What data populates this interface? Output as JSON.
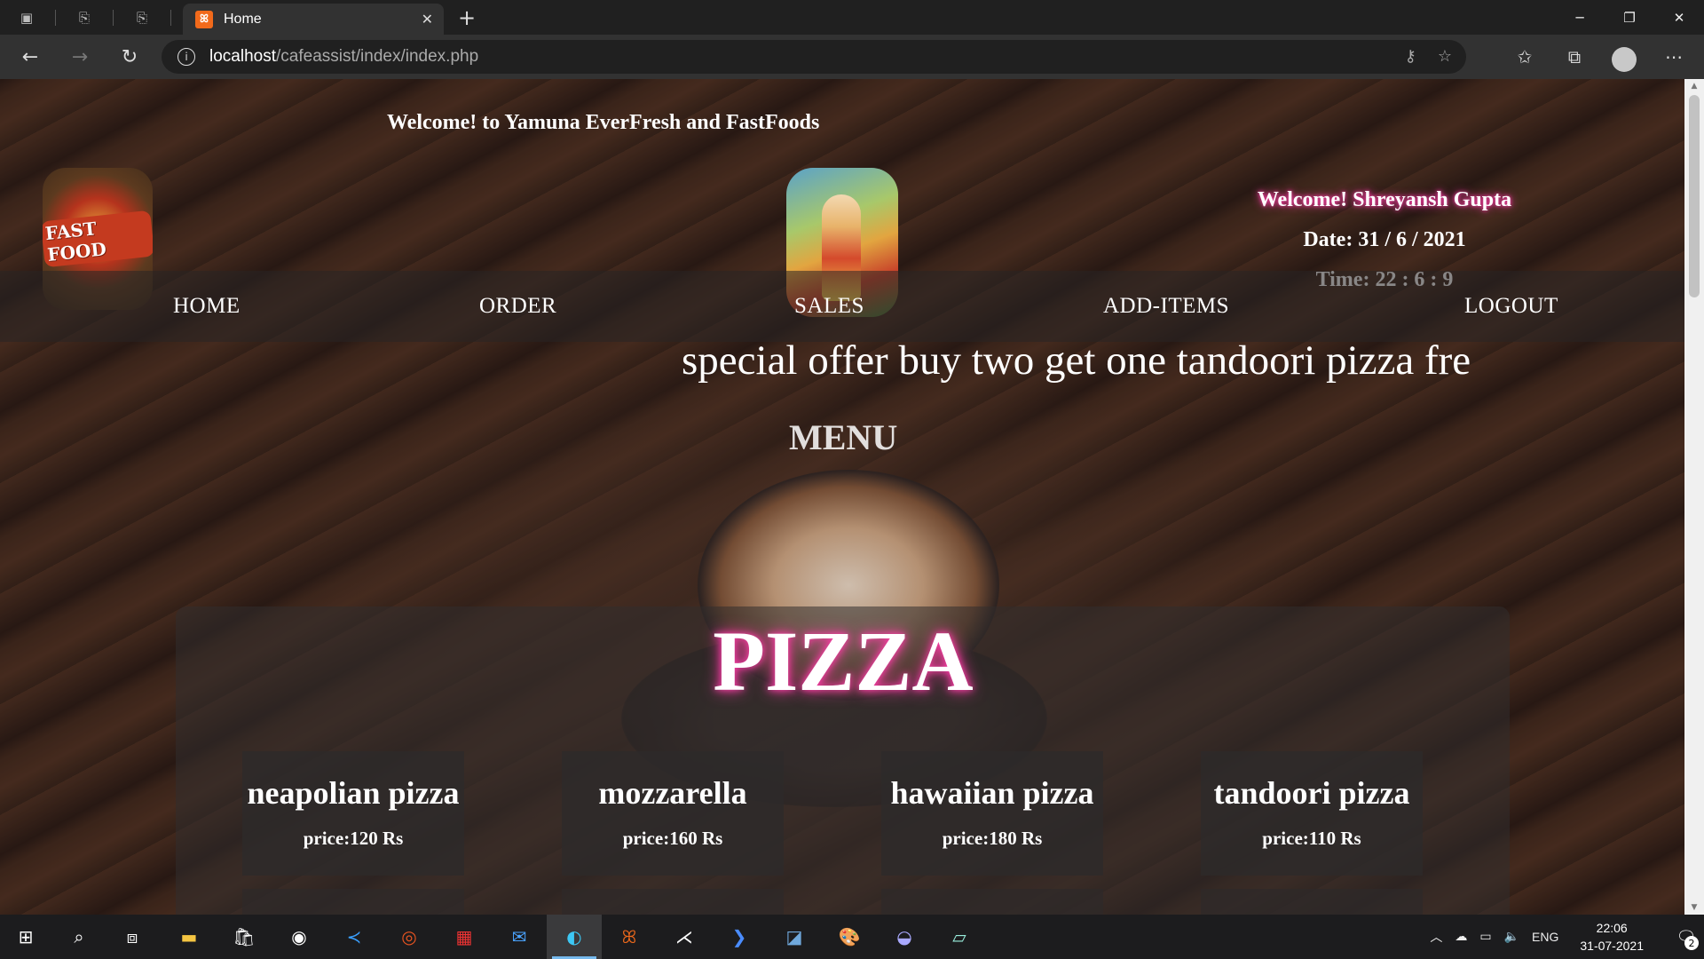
{
  "browser": {
    "tab_title": "Home",
    "tab_favicon": "xampp-icon",
    "url_host": "localhost",
    "url_path": "/cafeassist/index/index.php"
  },
  "header": {
    "welcome_top": "Welcome! to Yamuna EverFresh and FastFoods",
    "logo_left_text": "FAST FOOD",
    "user_welcome": "Welcome! Shreyansh Gupta",
    "date": "Date: 31 / 6 / 2021",
    "time": "Time: 22 : 6 : 9"
  },
  "nav": {
    "items": [
      {
        "label": "HOME"
      },
      {
        "label": "ORDER"
      },
      {
        "label": "SALES"
      },
      {
        "label": "ADD-ITEMS"
      },
      {
        "label": "LOGOUT"
      }
    ]
  },
  "marquee": "special offer buy two get one tandoori pizza fre",
  "menu_title": "MENU",
  "category": {
    "title": "PIZZA",
    "items": [
      {
        "name": "neapolian pizza",
        "price": "price:120 Rs"
      },
      {
        "name": "mozzarella",
        "price": "price:160 Rs"
      },
      {
        "name": "hawaiian pizza",
        "price": "price:180 Rs"
      },
      {
        "name": "tandoori pizza",
        "price": "price:110 Rs"
      }
    ]
  },
  "taskbar": {
    "lang": "ENG",
    "time": "22:06",
    "date": "31-07-2021",
    "notifications": "2"
  },
  "colors": {
    "glow_pink": "#ff3ca8",
    "edge_accent": "#76b9ed",
    "xampp_orange": "#f26a1b"
  }
}
